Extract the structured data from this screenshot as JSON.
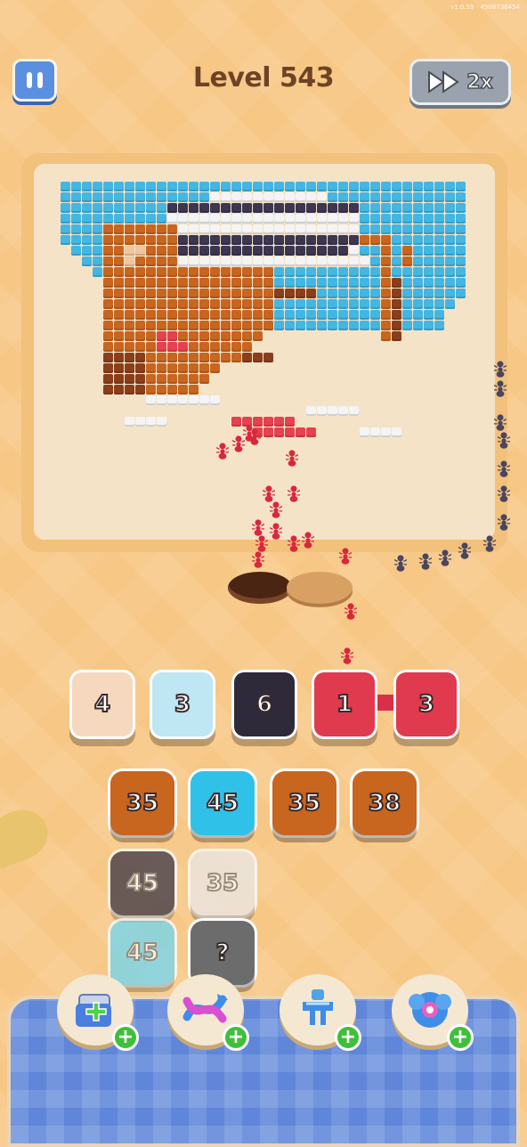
{
  "version_text": "v1.0.59 - 4908736454",
  "header": {
    "level_title": "Level 543",
    "speed_label": "2x"
  },
  "queue": [
    {
      "count": "4",
      "color": "#f6d8bf"
    },
    {
      "count": "3",
      "color": "#bfe6f3"
    },
    {
      "count": "6",
      "color": "#2f2a3a"
    },
    {
      "count": "1",
      "color": "#e03a4f"
    },
    {
      "count": "3",
      "color": "#e03a4f"
    }
  ],
  "stacks": {
    "row1": [
      {
        "count": "35",
        "color": "#c8651f"
      },
      {
        "count": "45",
        "color": "#2fc1e8"
      },
      {
        "count": "35",
        "color": "#c8651f"
      },
      {
        "count": "38",
        "color": "#c8651f"
      }
    ],
    "row2": [
      {
        "count": "45",
        "color": "#3a3545"
      },
      {
        "count": "35",
        "color": "#e9e9e9"
      }
    ],
    "row3": [
      {
        "count": "45",
        "color": "#6fd6f2"
      },
      {
        "count": "?",
        "color": "#6c6c6c"
      }
    ]
  },
  "boosters": [
    {
      "icon": "add-slot-icon",
      "plus": "+"
    },
    {
      "icon": "shuffle-arrows-icon",
      "plus": "+"
    },
    {
      "icon": "magnet-claw-icon",
      "plus": "+"
    },
    {
      "icon": "vacuum-icon",
      "plus": "+"
    }
  ]
}
